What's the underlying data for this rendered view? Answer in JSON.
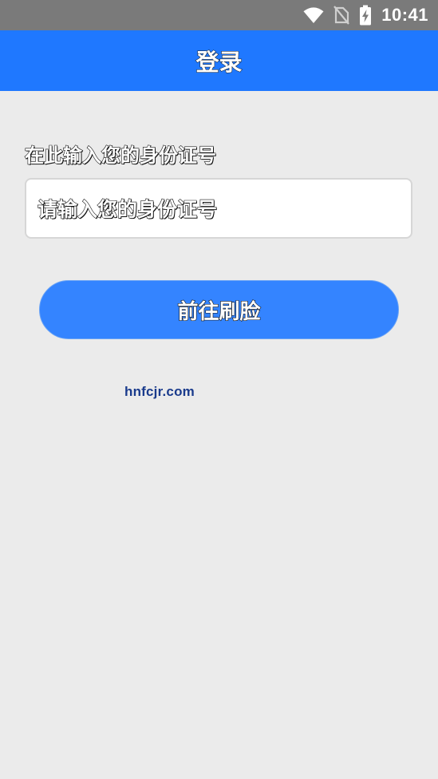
{
  "status_bar": {
    "time": "10:41",
    "icons": [
      "wifi-icon",
      "no-sim-icon",
      "battery-charging-icon"
    ]
  },
  "app_bar": {
    "title": "登录",
    "color": "#1f78ff"
  },
  "form": {
    "id_label": "在此输入您的身份证号",
    "id_placeholder": "请输入您的身份证号",
    "submit_label": "前往刷脸",
    "button_color": "#3484ff"
  },
  "watermark": {
    "text": "hnfcjr.com"
  }
}
